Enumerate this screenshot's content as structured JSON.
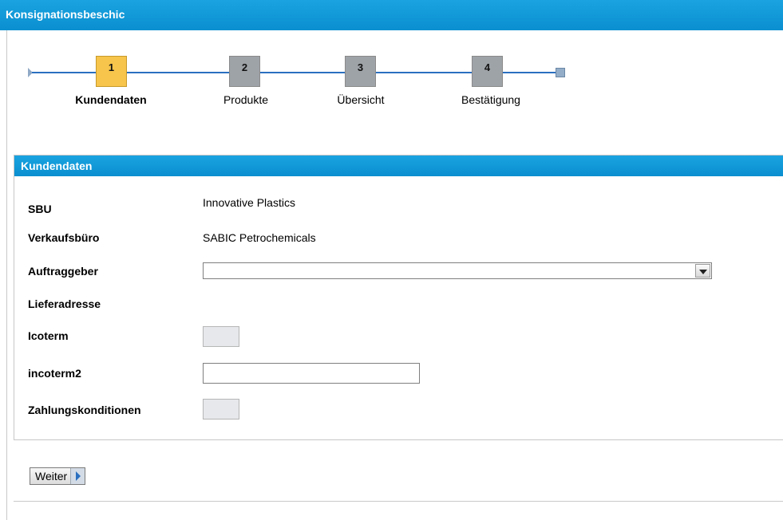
{
  "window": {
    "title": "Konsignationsbeschic"
  },
  "wizard": {
    "steps": [
      {
        "number": "1",
        "label": "Kundendaten",
        "active": true
      },
      {
        "number": "2",
        "label": "Produkte",
        "active": false
      },
      {
        "number": "3",
        "label": "Übersicht",
        "active": false
      },
      {
        "number": "4",
        "label": "Bestätigung",
        "active": false
      }
    ]
  },
  "panel": {
    "title": "Kundendaten",
    "fields": {
      "sbu": {
        "label": "SBU",
        "value": "Innovative Plastics"
      },
      "sales_office": {
        "label": "Verkaufsbüro",
        "value": "SABIC Petrochemicals"
      },
      "customer": {
        "label": "Auftraggeber",
        "value": ""
      },
      "delivery_address": {
        "label": "Lieferadresse"
      },
      "icoterm": {
        "label": "Icoterm",
        "value": ""
      },
      "incoterm2": {
        "label": "incoterm2",
        "value": ""
      },
      "payment_terms": {
        "label": "Zahlungskonditionen",
        "value": ""
      }
    }
  },
  "actions": {
    "next_label": "Weiter"
  },
  "colors": {
    "header": "#0a9ad9",
    "active_step": "#f7c54b",
    "inactive_step": "#9ea3a8",
    "progress_line": "#2a6fc0"
  }
}
